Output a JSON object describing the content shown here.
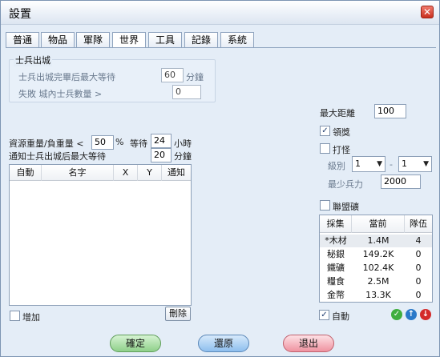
{
  "window": {
    "title": "設置"
  },
  "tabs": [
    {
      "label": "普通"
    },
    {
      "label": "物品"
    },
    {
      "label": "軍隊"
    },
    {
      "label": "世界"
    },
    {
      "label": "工具"
    },
    {
      "label": "記錄"
    },
    {
      "label": "系統"
    }
  ],
  "active_tab": "世界",
  "soldier_group": {
    "title": "士兵出城",
    "wait_label": "士兵出城完畢后最大等待",
    "wait_value": "60",
    "wait_unit": "分鐘",
    "fail_label": "失敗 城內士兵數量 >",
    "fail_value": "0"
  },
  "resource": {
    "ratio_label": "資源重量/負重量 <",
    "ratio_value": "50",
    "ratio_unit": "%",
    "wait_label": "等待",
    "wait_value": "24",
    "wait_unit": "小時",
    "notify_label": "通知士兵出城后最大等待",
    "notify_value": "20",
    "notify_unit": "分鐘"
  },
  "list_table": {
    "columns": [
      "自動",
      "名字",
      "X",
      "Y",
      "通知"
    ],
    "rows": []
  },
  "add_label": "增加",
  "add_checked": false,
  "delete_label": "刪除",
  "max_distance": {
    "label": "最大距離",
    "value": "100"
  },
  "lead_award": {
    "label": "領獎",
    "checked": true
  },
  "hunt": {
    "label": "打怪",
    "checked": false,
    "level_label": "級別",
    "level_from": "1",
    "separator": "-",
    "level_to": "1",
    "min_force_label": "最少兵力",
    "min_force_value": "2000"
  },
  "alliance_mine": {
    "label": "聯盟礦",
    "checked": false
  },
  "collect_table": {
    "columns": [
      "採集",
      "當前",
      "隊伍"
    ],
    "rows": [
      {
        "name": "*木材",
        "current": "1.4M",
        "team": "4"
      },
      {
        "name": "秘銀",
        "current": "149.2K",
        "team": "0"
      },
      {
        "name": "鐵礦",
        "current": "102.4K",
        "team": "0"
      },
      {
        "name": "糧食",
        "current": "2.5M",
        "team": "0"
      },
      {
        "name": "金幣",
        "current": "13.3K",
        "team": "0"
      }
    ]
  },
  "auto": {
    "label": "自動",
    "checked": true
  },
  "icons": {
    "confirm": "check-circle-icon",
    "up": "arrow-up-icon",
    "down": "arrow-down-icon"
  },
  "buttons": {
    "ok": "確定",
    "restore": "還原",
    "exit": "退出"
  },
  "colors": {
    "ok": "#9fd89a",
    "restore": "#9cc6ef",
    "exit": "#f29aa6"
  }
}
